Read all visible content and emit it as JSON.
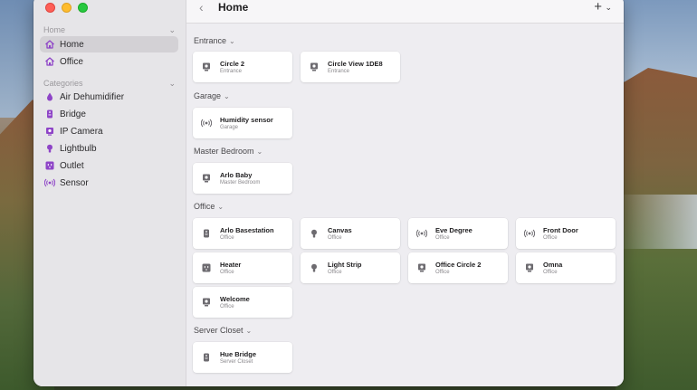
{
  "window": {
    "title": "Home"
  },
  "sidebar": {
    "home_section": "Home",
    "homes": [
      {
        "label": "Home",
        "icon": "house-icon",
        "active": true
      },
      {
        "label": "Office",
        "icon": "house-icon",
        "active": false
      }
    ],
    "categories_section": "Categories",
    "categories": [
      {
        "label": "Air Dehumidifier",
        "icon": "droplet-icon",
        "color": "#8e44c7"
      },
      {
        "label": "Bridge",
        "icon": "bridge-icon",
        "color": "#8e44c7"
      },
      {
        "label": "IP Camera",
        "icon": "camera-icon",
        "color": "#8e44c7"
      },
      {
        "label": "Lightbulb",
        "icon": "lightbulb-icon",
        "color": "#8e44c7"
      },
      {
        "label": "Outlet",
        "icon": "outlet-icon",
        "color": "#8e44c7"
      },
      {
        "label": "Sensor",
        "icon": "sensor-icon",
        "color": "#8e44c7"
      }
    ]
  },
  "groups": {
    "entrance": {
      "label": "Entrance",
      "tiles": [
        {
          "name": "Circle 2",
          "room": "Entrance",
          "icon": "camera-icon"
        },
        {
          "name": "Circle View 1DE8",
          "room": "Entrance",
          "icon": "camera-icon"
        }
      ]
    },
    "garage": {
      "label": "Garage",
      "tiles": [
        {
          "name": "Humidity sensor",
          "room": "Garage",
          "icon": "sensor-icon"
        }
      ]
    },
    "master_bedroom": {
      "label": "Master Bedroom",
      "tiles": [
        {
          "name": "Arlo Baby",
          "room": "Master Bedroom",
          "icon": "camera-icon"
        }
      ]
    },
    "office": {
      "label": "Office",
      "tiles": [
        {
          "name": "Arlo Basestation",
          "room": "Office",
          "icon": "bridge-icon"
        },
        {
          "name": "Canvas",
          "room": "Office",
          "icon": "lightbulb-icon"
        },
        {
          "name": "Eve Degree",
          "room": "Office",
          "icon": "sensor-icon"
        },
        {
          "name": "Front Door",
          "room": "Office",
          "icon": "sensor-icon"
        },
        {
          "name": "Heater",
          "room": "Office",
          "icon": "outlet-icon"
        },
        {
          "name": "Light Strip",
          "room": "Office",
          "icon": "lightbulb-icon"
        },
        {
          "name": "Office Circle 2",
          "room": "Office",
          "icon": "camera-icon"
        },
        {
          "name": "Omna",
          "room": "Office",
          "icon": "camera-icon"
        },
        {
          "name": "Welcome",
          "room": "Office",
          "icon": "camera-icon"
        }
      ]
    },
    "server_closet": {
      "label": "Server Closet",
      "tiles": [
        {
          "name": "Hue Bridge",
          "room": "Server Closet",
          "icon": "bridge-icon"
        }
      ]
    }
  }
}
